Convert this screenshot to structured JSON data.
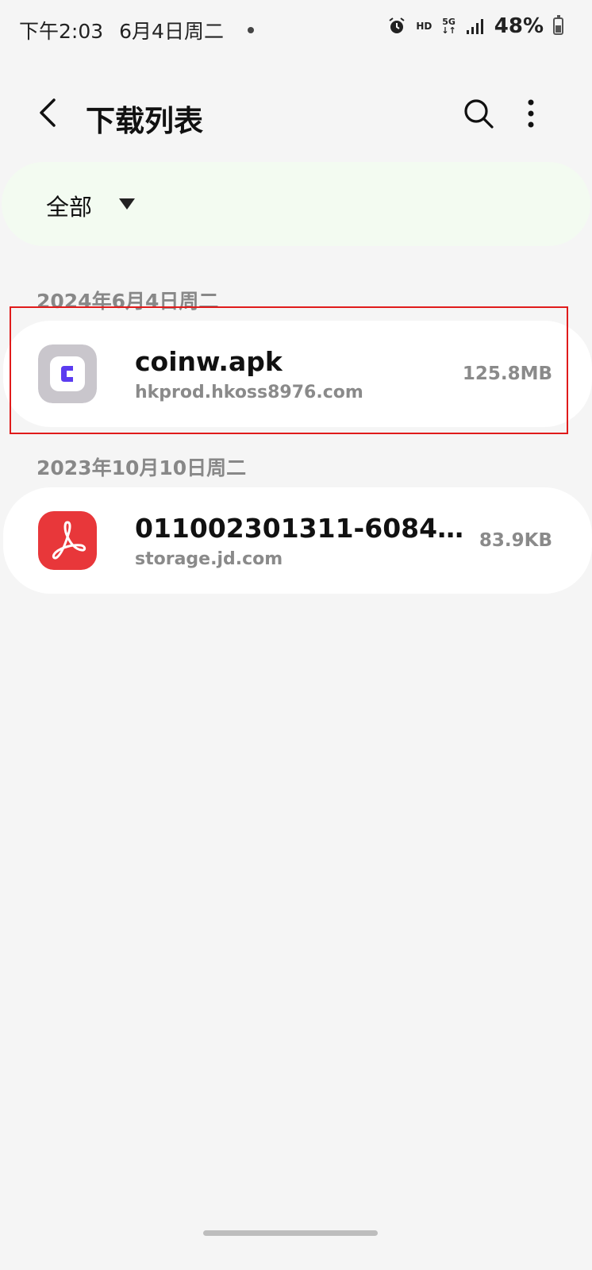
{
  "status_bar": {
    "time": "下午2:03",
    "date": "6月4日周二",
    "hd": "HD",
    "network": "5G",
    "battery": "48%"
  },
  "header": {
    "title": "下载列表"
  },
  "filter": {
    "label": "全部"
  },
  "groups": [
    {
      "date": "2024年6月4日周二",
      "items": [
        {
          "name": "coinw.apk",
          "source": "hkprod.hkoss8976.com",
          "size": "125.8MB",
          "icon": "apk-app-icon"
        }
      ]
    },
    {
      "date": "2023年10月10日周二",
      "items": [
        {
          "name": "011002301311-6084291...",
          "source": "storage.jd.com",
          "size": "83.9KB",
          "icon": "pdf-file-icon"
        }
      ]
    }
  ],
  "colors": {
    "highlight": "#e01b1b",
    "pdf_red": "#e8373a",
    "apk_purple": "#5b3cf0"
  }
}
